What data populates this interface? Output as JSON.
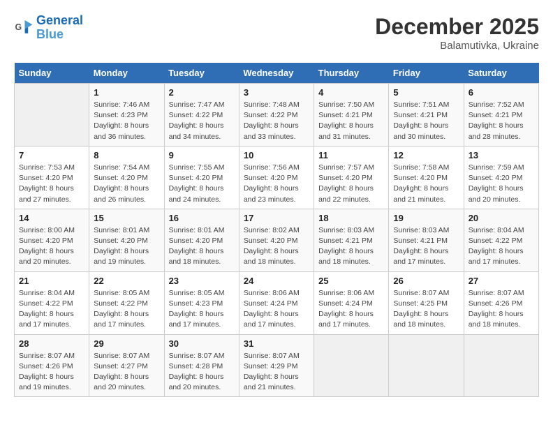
{
  "logo": {
    "line1": "General",
    "line2": "Blue"
  },
  "title": "December 2025",
  "subtitle": "Balamutivka, Ukraine",
  "days_header": [
    "Sunday",
    "Monday",
    "Tuesday",
    "Wednesday",
    "Thursday",
    "Friday",
    "Saturday"
  ],
  "weeks": [
    [
      {
        "day": "",
        "info": ""
      },
      {
        "day": "1",
        "info": "Sunrise: 7:46 AM\nSunset: 4:23 PM\nDaylight: 8 hours\nand 36 minutes."
      },
      {
        "day": "2",
        "info": "Sunrise: 7:47 AM\nSunset: 4:22 PM\nDaylight: 8 hours\nand 34 minutes."
      },
      {
        "day": "3",
        "info": "Sunrise: 7:48 AM\nSunset: 4:22 PM\nDaylight: 8 hours\nand 33 minutes."
      },
      {
        "day": "4",
        "info": "Sunrise: 7:50 AM\nSunset: 4:21 PM\nDaylight: 8 hours\nand 31 minutes."
      },
      {
        "day": "5",
        "info": "Sunrise: 7:51 AM\nSunset: 4:21 PM\nDaylight: 8 hours\nand 30 minutes."
      },
      {
        "day": "6",
        "info": "Sunrise: 7:52 AM\nSunset: 4:21 PM\nDaylight: 8 hours\nand 28 minutes."
      }
    ],
    [
      {
        "day": "7",
        "info": "Sunrise: 7:53 AM\nSunset: 4:20 PM\nDaylight: 8 hours\nand 27 minutes."
      },
      {
        "day": "8",
        "info": "Sunrise: 7:54 AM\nSunset: 4:20 PM\nDaylight: 8 hours\nand 26 minutes."
      },
      {
        "day": "9",
        "info": "Sunrise: 7:55 AM\nSunset: 4:20 PM\nDaylight: 8 hours\nand 24 minutes."
      },
      {
        "day": "10",
        "info": "Sunrise: 7:56 AM\nSunset: 4:20 PM\nDaylight: 8 hours\nand 23 minutes."
      },
      {
        "day": "11",
        "info": "Sunrise: 7:57 AM\nSunset: 4:20 PM\nDaylight: 8 hours\nand 22 minutes."
      },
      {
        "day": "12",
        "info": "Sunrise: 7:58 AM\nSunset: 4:20 PM\nDaylight: 8 hours\nand 21 minutes."
      },
      {
        "day": "13",
        "info": "Sunrise: 7:59 AM\nSunset: 4:20 PM\nDaylight: 8 hours\nand 20 minutes."
      }
    ],
    [
      {
        "day": "14",
        "info": "Sunrise: 8:00 AM\nSunset: 4:20 PM\nDaylight: 8 hours\nand 20 minutes."
      },
      {
        "day": "15",
        "info": "Sunrise: 8:01 AM\nSunset: 4:20 PM\nDaylight: 8 hours\nand 19 minutes."
      },
      {
        "day": "16",
        "info": "Sunrise: 8:01 AM\nSunset: 4:20 PM\nDaylight: 8 hours\nand 18 minutes."
      },
      {
        "day": "17",
        "info": "Sunrise: 8:02 AM\nSunset: 4:20 PM\nDaylight: 8 hours\nand 18 minutes."
      },
      {
        "day": "18",
        "info": "Sunrise: 8:03 AM\nSunset: 4:21 PM\nDaylight: 8 hours\nand 18 minutes."
      },
      {
        "day": "19",
        "info": "Sunrise: 8:03 AM\nSunset: 4:21 PM\nDaylight: 8 hours\nand 17 minutes."
      },
      {
        "day": "20",
        "info": "Sunrise: 8:04 AM\nSunset: 4:22 PM\nDaylight: 8 hours\nand 17 minutes."
      }
    ],
    [
      {
        "day": "21",
        "info": "Sunrise: 8:04 AM\nSunset: 4:22 PM\nDaylight: 8 hours\nand 17 minutes."
      },
      {
        "day": "22",
        "info": "Sunrise: 8:05 AM\nSunset: 4:22 PM\nDaylight: 8 hours\nand 17 minutes."
      },
      {
        "day": "23",
        "info": "Sunrise: 8:05 AM\nSunset: 4:23 PM\nDaylight: 8 hours\nand 17 minutes."
      },
      {
        "day": "24",
        "info": "Sunrise: 8:06 AM\nSunset: 4:24 PM\nDaylight: 8 hours\nand 17 minutes."
      },
      {
        "day": "25",
        "info": "Sunrise: 8:06 AM\nSunset: 4:24 PM\nDaylight: 8 hours\nand 17 minutes."
      },
      {
        "day": "26",
        "info": "Sunrise: 8:07 AM\nSunset: 4:25 PM\nDaylight: 8 hours\nand 18 minutes."
      },
      {
        "day": "27",
        "info": "Sunrise: 8:07 AM\nSunset: 4:26 PM\nDaylight: 8 hours\nand 18 minutes."
      }
    ],
    [
      {
        "day": "28",
        "info": "Sunrise: 8:07 AM\nSunset: 4:26 PM\nDaylight: 8 hours\nand 19 minutes."
      },
      {
        "day": "29",
        "info": "Sunrise: 8:07 AM\nSunset: 4:27 PM\nDaylight: 8 hours\nand 20 minutes."
      },
      {
        "day": "30",
        "info": "Sunrise: 8:07 AM\nSunset: 4:28 PM\nDaylight: 8 hours\nand 20 minutes."
      },
      {
        "day": "31",
        "info": "Sunrise: 8:07 AM\nSunset: 4:29 PM\nDaylight: 8 hours\nand 21 minutes."
      },
      {
        "day": "",
        "info": ""
      },
      {
        "day": "",
        "info": ""
      },
      {
        "day": "",
        "info": ""
      }
    ]
  ]
}
